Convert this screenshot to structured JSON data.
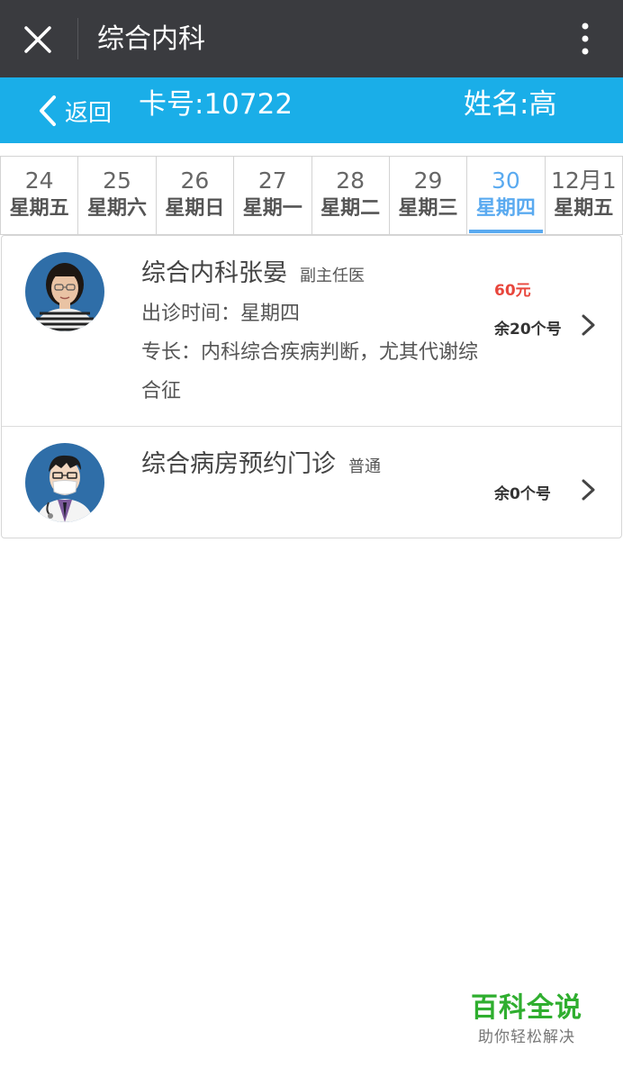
{
  "titlebar": {
    "title": "综合内科"
  },
  "header": {
    "back_label": "返回",
    "card_no": "卡号:10722",
    "name": "姓名:高"
  },
  "dates": [
    {
      "day": "24",
      "weekday": "星期五",
      "active": false
    },
    {
      "day": "25",
      "weekday": "星期六",
      "active": false
    },
    {
      "day": "26",
      "weekday": "星期日",
      "active": false
    },
    {
      "day": "27",
      "weekday": "星期一",
      "active": false
    },
    {
      "day": "28",
      "weekday": "星期二",
      "active": false
    },
    {
      "day": "29",
      "weekday": "星期三",
      "active": false
    },
    {
      "day": "30",
      "weekday": "星期四",
      "active": true
    },
    {
      "day": "12月1",
      "weekday": "星期五",
      "active": false
    }
  ],
  "doctors": [
    {
      "name": "综合内科张晏",
      "rank": "副主任医",
      "time": "出诊时间：星期四",
      "specialty": "专长：内科综合疾病判断，尤其代谢综合征",
      "price": "60元",
      "remaining": "余20个号"
    },
    {
      "name": "综合病房预约门诊",
      "rank": "普通",
      "remaining": "余0个号"
    }
  ],
  "watermark": {
    "title": "百科全说",
    "subtitle": "助你轻松解决"
  },
  "colors": {
    "titlebar": "#3a3b3f",
    "header": "#1aaee8",
    "active_tab": "#5aaaf0",
    "price": "#e8463c",
    "watermark": "#2fae2f"
  }
}
